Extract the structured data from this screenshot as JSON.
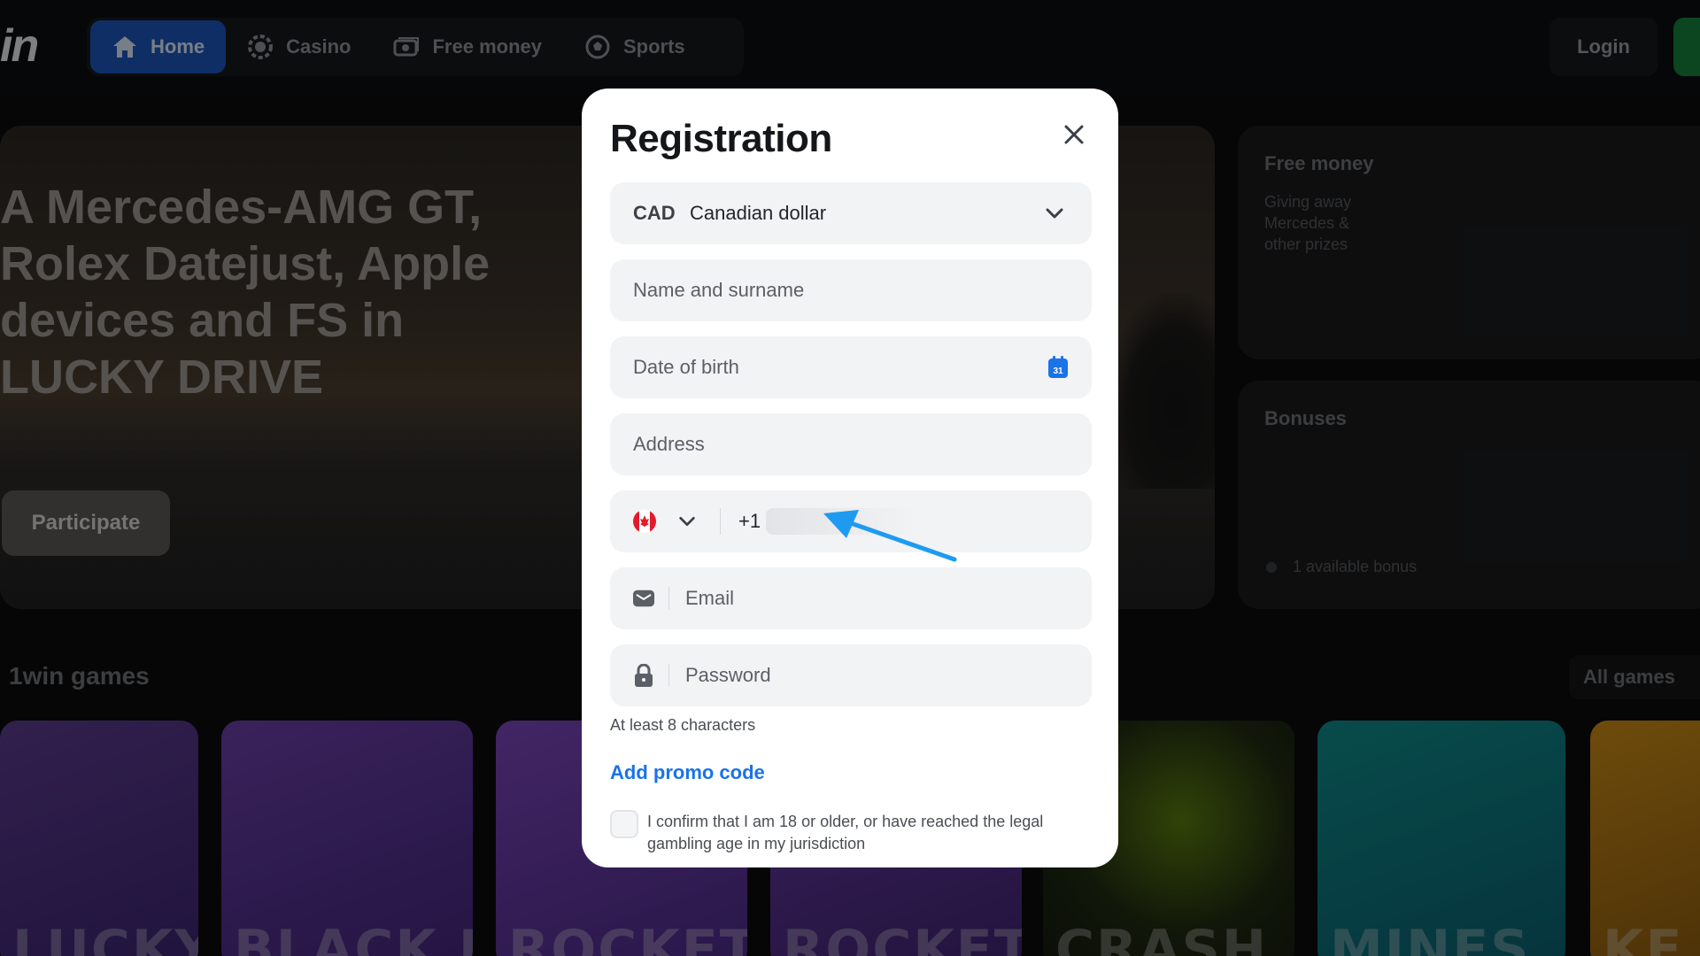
{
  "header": {
    "logo": "in",
    "nav": [
      {
        "label": "Home",
        "icon": "home-icon",
        "active": true
      },
      {
        "label": "Casino",
        "icon": "casino-chip-icon",
        "active": false
      },
      {
        "label": "Free money",
        "icon": "money-icon",
        "active": false
      },
      {
        "label": "Sports",
        "icon": "soccer-ball-icon",
        "active": false
      }
    ],
    "login_label": "Login"
  },
  "hero": {
    "title": "A Mercedes-AMG GT, Rolex Datejust, Apple devices and FS in LUCKY DRIVE",
    "cta_label": "Participate"
  },
  "side_cards": {
    "free_money": {
      "title": "Free money",
      "desc": "Giving away Mercedes & other prizes"
    },
    "bonuses": {
      "title": "Bonuses",
      "status": "1 available bonus"
    }
  },
  "games_section": {
    "title": "1win games",
    "all_label": "All games",
    "games": [
      "LUCKY JET",
      "BLACK JACK",
      "ROCKET",
      "ROCKETX",
      "CRASH",
      "MINES",
      "KE"
    ]
  },
  "modal": {
    "title": "Registration",
    "currency": {
      "code": "CAD",
      "name": "Canadian dollar"
    },
    "name_placeholder": "Name and surname",
    "dob_placeholder": "Date of birth",
    "calendar_day": "31",
    "address_placeholder": "Address",
    "phone": {
      "dial_code": "+1",
      "country": "Canada"
    },
    "email_placeholder": "Email",
    "password_placeholder": "Password",
    "password_hint": "At least 8 characters",
    "promo_label": "Add promo code",
    "age_confirm": "I confirm that I am 18 or older, or have reached the legal gambling age in my jurisdiction"
  },
  "colors": {
    "accent": "#1a73e8",
    "nav_active": "#1c55b8",
    "annotation_arrow": "#1e9bf0"
  }
}
